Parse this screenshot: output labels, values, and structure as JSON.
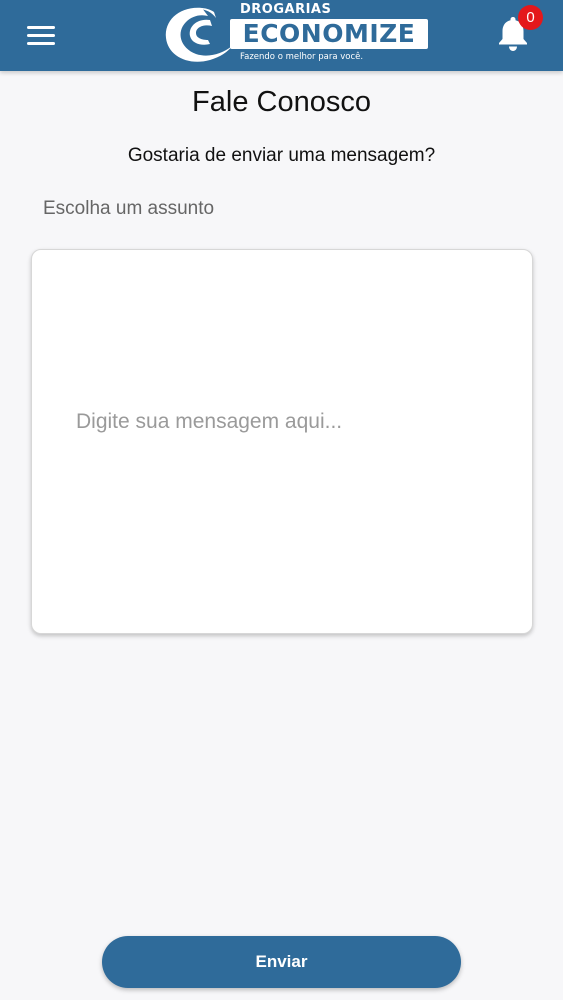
{
  "header": {
    "menu_icon": "hamburger-menu-icon",
    "logo": {
      "top_text": "DROGARIAS",
      "brand": "ECONOMIZE",
      "tagline": "Fazendo o melhor para você."
    },
    "notifications": {
      "icon": "bell-icon",
      "count": "0"
    },
    "bar_color": "#2f6b9a"
  },
  "main": {
    "title": "Fale Conosco",
    "subtitle": "Gostaria de enviar uma mensagem?",
    "subject_placeholder": "Escolha um assunto",
    "message_placeholder": "Digite sua mensagem aqui..."
  },
  "footer": {
    "send_label": "Enviar"
  },
  "colors": {
    "accent": "#2f6b9a",
    "badge": "#e4181b"
  }
}
